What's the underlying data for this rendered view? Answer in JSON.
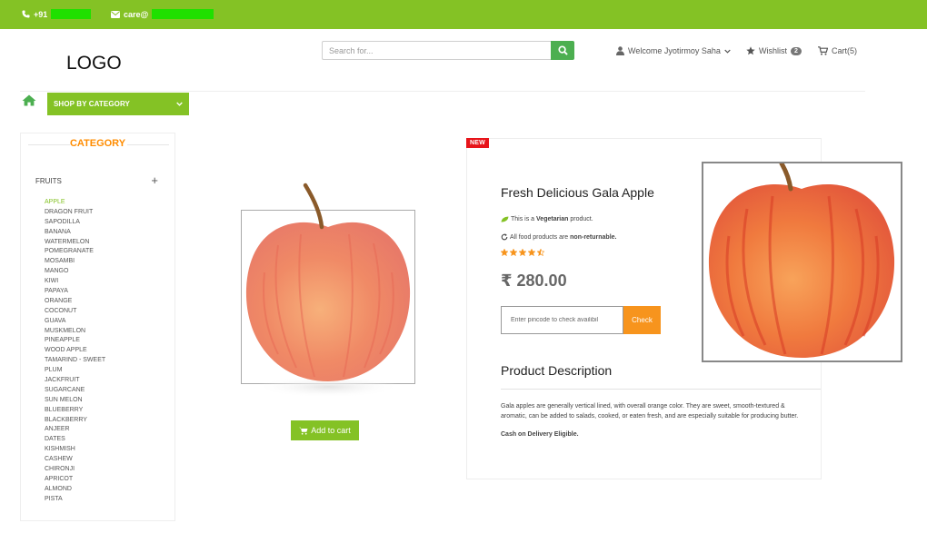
{
  "topbar": {
    "phone_text": "+91 ",
    "email_text": "care@"
  },
  "header": {
    "logo": "LOGO",
    "search_placeholder": "Search for...",
    "welcome": "Welcome Jyotirmoy Saha",
    "wishlist_label": "Wishlist",
    "wishlist_count": "2",
    "cart_label": "Cart(5)"
  },
  "nav": {
    "category_button": "SHOP BY CATEGORY"
  },
  "sidebar": {
    "title": "CATEGORY",
    "group": "FRUITS",
    "group_toggle": "+",
    "items": [
      "APPLE",
      "DRAGON FRUIT",
      "SAPODILLA",
      "BANANA",
      "WATERMELON",
      "POMEGRANATE",
      "MOSAMBI",
      "MANGO",
      "KIWI",
      "PAPAYA",
      "ORANGE",
      "COCONUT",
      "GUAVA",
      "MUSKMELON",
      "PINEAPPLE",
      "WOOD APPLE",
      "TAMARIND - SWEET",
      "PLUM",
      "JACKFRUIT",
      "SUGARCANE",
      "SUN MELON",
      "BLUEBERRY",
      "BLACKBERRY",
      "ANJEER",
      "DATES",
      "KISHMISH",
      "CASHEW",
      "CHIRONJI",
      "APRICOT",
      "ALMOND",
      "PISTA"
    ],
    "active_index": 0
  },
  "product": {
    "badge": "NEW",
    "title": "Fresh Delicious Gala Apple",
    "veg_prefix": "This is a ",
    "veg_bold": "Vegetarian",
    "veg_suffix": " product.",
    "return_prefix": "All food products are ",
    "return_bold": "non-returnable.",
    "rating_stars": 4.5,
    "price": "₹ 280.00",
    "pincode_placeholder": "Enter pincode to check availibil",
    "check_label": "Check",
    "add_to_cart": "Add to cart",
    "description_title": "Product Description",
    "description": "Gala apples are generally vertical lined, with overall orange color. They are sweet, smooth-textured & aromatic, can be added to salads, cooked, or eaten fresh, and are especially suitable for producing butter.",
    "cod_text": "Cash on Delivery Eligible."
  },
  "colors": {
    "brand_green": "#84c225",
    "search_button": "#4caf50",
    "accent_orange": "#f7941d",
    "new_badge": "#e7141a",
    "category_title": "#ff8c00"
  },
  "icons": [
    "phone-icon",
    "mail-icon",
    "search-icon",
    "user-icon",
    "chevron-down-icon",
    "star-icon",
    "cart-icon",
    "home-icon",
    "leaf-icon",
    "refresh-icon"
  ]
}
